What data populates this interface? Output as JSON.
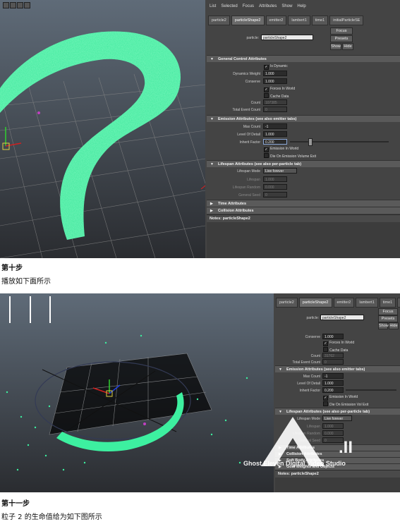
{
  "screen1": {
    "menu": [
      "List",
      "Selected",
      "Focus",
      "Attributes",
      "Show",
      "Help"
    ],
    "tabs": [
      "particle2",
      "particleShape2",
      "emitter2",
      "lambert1",
      "time1",
      "initialParticleSE"
    ],
    "particle_label": "particle:",
    "particle_value": "particleShape2",
    "buttons": {
      "focus": "Focus",
      "presets": "Presets",
      "show": "Show",
      "hide": "Hide"
    },
    "general": {
      "title": "General Control Attributes",
      "is_dynamic": "Is Dynamic",
      "dynamics_weight_label": "Dynamics Weight",
      "dynamics_weight": "1.000",
      "conserve_label": "Conserve",
      "conserve": "1.000",
      "forces_in_world": "Forces In World",
      "cache_data": "Cache Data",
      "count_label": "Count",
      "count": "107385",
      "total_event_count_label": "Total Event Count",
      "total_event_count": "0"
    },
    "emission": {
      "title": "Emission Attributes (see also emitter tabs)",
      "max_count_label": "Max Count",
      "max_count": "-1",
      "level_of_detail_label": "Level Of Detail",
      "level_of_detail": "1.000",
      "inherit_factor_label": "Inherit Factor",
      "inherit_factor": "0.200",
      "emission_in_world": "Emission In World",
      "die_on_volume_exit": "Die On Emission Volume Exit"
    },
    "lifespan": {
      "title": "Lifespan Attributes (see also per-particle tab)",
      "mode_label": "Lifespan Mode",
      "mode_value": "Live forever",
      "lifespan_label": "Lifespan",
      "lifespan": "1.000",
      "random_label": "Lifespan Random",
      "random": "0.000",
      "seed_label": "General Seed",
      "seed": "0"
    },
    "time_attrs": "Time Attributes",
    "collision_attrs": "Collision Attributes",
    "notes": "Notes: particleShape2"
  },
  "caption1": {
    "step": "第十步",
    "text": "播放如下面所示"
  },
  "screen2": {
    "tabs": [
      "particle2",
      "particleShape2",
      "emitter2",
      "lambert1",
      "time1",
      "initialPartic"
    ],
    "particle_label": "particle:",
    "particle_value": "particleShape2",
    "buttons": {
      "focus": "Focus",
      "presets": "Presets",
      "show": "Show",
      "hide": "Hide"
    },
    "conserve_label": "Conserve",
    "conserve": "1.000",
    "forces_in_world": "Forces In World",
    "cache_data": "Cache Data",
    "count_label": "Count",
    "count": "31762",
    "total_event_count_label": "Total Event Count",
    "total_event_count": "0",
    "emission_title": "Emission Attributes (see also emitter tabs)",
    "max_count_label": "Max Count",
    "max_count": "-1",
    "level_of_detail_label": "Level Of Detail",
    "level_of_detail": "1.000",
    "inherit_factor_label": "Inherit Factor",
    "inherit_factor": "0.200",
    "emission_in_world": "Emission In World",
    "die_on_volume_exit": "Die On Emission Vol Exit",
    "lifespan_title": "Lifespan Attributes (see also per-particle tab)",
    "mode_label": "Lifespan Mode",
    "mode_value": "Live forever",
    "lifespan_label": "Lifespan",
    "lifespan": "1.000",
    "random_label": "Lifespan Random",
    "random": "0.000",
    "seed_label": "General Seed",
    "seed": "0",
    "sections": [
      "Time Attributes",
      "Collision Attributes",
      "Soft Body Attributes",
      "Goal Weights and Objects"
    ],
    "notes": "Notes: particleShape2"
  },
  "watermark": {
    "line1": "Ghost Eleven Digital Video Studio",
    "mark": ".II"
  },
  "caption2": {
    "step": "第十一步",
    "text": "粒子 2 的生命值给为如下图所示"
  },
  "colors": {
    "particle": "#3df0a0",
    "panel": "#444444",
    "viewport": "#4d5560",
    "annotation": "#d82020"
  }
}
